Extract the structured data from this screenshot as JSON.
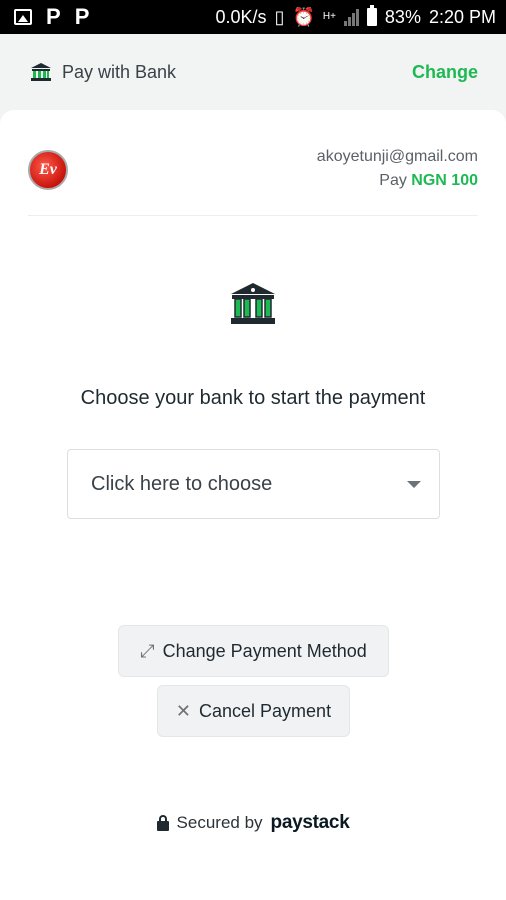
{
  "status_bar": {
    "left_icons": [
      "gallery-icon",
      "p-icon",
      "p-icon"
    ],
    "p_glyph": "P",
    "net_speed": "0.0K/s",
    "network_type": "H+",
    "battery": "83%",
    "time": "2:20 PM"
  },
  "header": {
    "title": "Pay with Bank",
    "change_label": "Change",
    "icon": "bank-icon"
  },
  "merchant": {
    "avatar_initials": "Ev",
    "email": "akoyetunji@gmail.com",
    "pay_label": "Pay",
    "amount": "NGN 100"
  },
  "main": {
    "icon": "bank-icon",
    "prompt": "Choose your bank to start the payment",
    "select_placeholder": "Click here to choose"
  },
  "actions": {
    "change_method_label": "Change Payment Method",
    "cancel_label": "Cancel Payment"
  },
  "footer": {
    "secured_label": "Secured by",
    "brand": "paystack"
  },
  "colors": {
    "accent_green": "#1fb954",
    "text_dark": "#1f2a30",
    "page_bg": "#f2f3f3"
  }
}
